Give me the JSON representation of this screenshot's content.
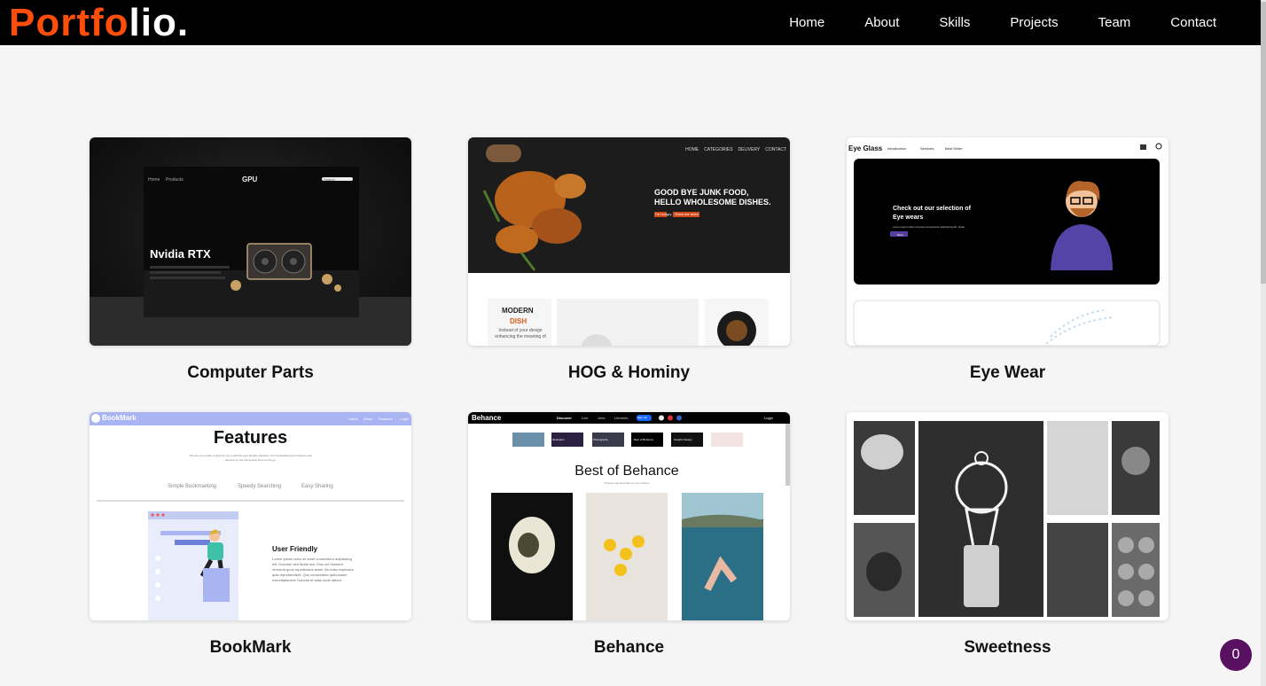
{
  "logo": {
    "part1": "Portfo",
    "part2": "lio."
  },
  "nav": {
    "items": [
      "Home",
      "About",
      "Skills",
      "Projects",
      "Team",
      "Contact"
    ]
  },
  "projects": [
    {
      "title": "Computer Parts"
    },
    {
      "title": "HOG & Hominy"
    },
    {
      "title": "Eye Wear"
    },
    {
      "title": "BookMark"
    },
    {
      "title": "Behance"
    },
    {
      "title": "Sweetness"
    }
  ],
  "thumbs": {
    "gpu": {
      "brand": "GPU",
      "nav1": "Home",
      "nav2": "Products",
      "search": "Search",
      "heading": "Nvidia RTX"
    },
    "hog": {
      "nav": [
        "HOME",
        "CATEGORIES",
        "DELIVERY",
        "CONTACT"
      ],
      "headline1": "GOOD BYE JUNK FOOD,",
      "headline2": "HELLO WHOLESOME DISHES.",
      "btn1": "I'm hungry",
      "btn2": "Show me more",
      "modern": "MODERN",
      "dish": "DISH",
      "desc": "Instead of your design enhancing the meaning of"
    },
    "eye": {
      "brand": "Eye Glass",
      "nav": [
        "Introduction",
        "Services",
        "Best Seller"
      ],
      "hero1": "Check out our selection of",
      "hero2": "Eye wears",
      "sub": "Lorem ipsum dolor sit amet consectetur adipisicing elit. Quas.",
      "btn": "More"
    },
    "bookmark": {
      "brand": "BookMark",
      "nav": [
        "Home",
        "About",
        "Features",
        "Login"
      ],
      "heading": "Features",
      "sub": "Our aim is to make it quick for you to add the your favorite websites. Your bookmarks sync between your devices so you can access them on the go.",
      "tabs": [
        "Simple Bookmarking",
        "Speedy Searching",
        "Easy Sharing"
      ],
      "feature": "User Friendly",
      "featureText": "Lorem ipsum dolor sit amet consectetur adipisicing elit. Dolorem sint facilis nisi. Eius vel dolorem nesciunt quos repellendus animi, illo iusto explicabo quis reprehenderit. Quo consectetur quibusdam exercitationem! Dolores et alias unde labore"
    },
    "behance": {
      "brand": "Behance",
      "nav": [
        "Discover",
        "Live",
        "Jobs",
        "Libraries"
      ],
      "signup": "Sign Up",
      "login": "Login",
      "chips": [
        "Illustration",
        "Photography",
        "Best of Behance",
        "Graphic Design"
      ],
      "heading": "Best of Behance",
      "sub": "Projects selected daily by our curators"
    }
  },
  "badge": {
    "count": "0"
  },
  "colors": {
    "accent": "#ff4d0a",
    "nav_bg": "#000000",
    "page_bg": "#f5f5f5",
    "badge": "#5a1060"
  }
}
